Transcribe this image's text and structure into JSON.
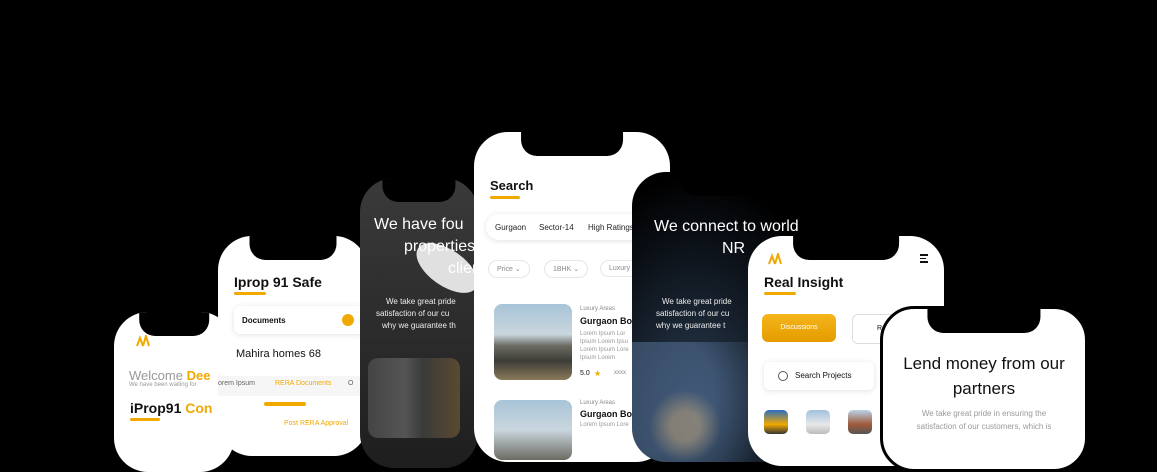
{
  "phone1": {
    "welcome": "Welcome",
    "welcome_highlight": "Dee",
    "subtitle": "We have been waiting for",
    "title_prefix": "iProp91",
    "title_highlight": "Con"
  },
  "phone2": {
    "title": "Iprop 91 Safe",
    "documents": "Documents",
    "project": "Mahira homes 68",
    "tabs": [
      "orem Ipsum",
      "RERA Documents",
      "O"
    ],
    "rera": "Post RERA Approval"
  },
  "phone3": {
    "headline_lines": [
      "We have fou",
      "properties",
      "clien"
    ],
    "body_lines": [
      "We take great pride",
      "satisfaction of our cu",
      "why we guarantee th"
    ]
  },
  "phone4": {
    "title": "Search",
    "filters": [
      "Gurgaon",
      "Sector-14",
      "High Ratings"
    ],
    "dropdowns": [
      "Price",
      "1BHK",
      "Luxury"
    ],
    "listings": [
      {
        "category": "Luxury Areas",
        "name": "Gurgaon Bo",
        "desc_lines": [
          "Lorem Ipsum Lor",
          "Ipsum Lorem Ipsu",
          "Lorem Ipsum Lore",
          "Ipsum Lorem"
        ],
        "rating": "5.0",
        "extra": "xxxx"
      },
      {
        "category": "Luxury Areas",
        "name": "Gurgaon Bo",
        "desc_lines": [
          "Lorem Ipsum Lore"
        ],
        "rating": "",
        "extra": ""
      }
    ]
  },
  "phone5": {
    "headline_lines": [
      "We connect to world",
      "NR"
    ],
    "body_lines": [
      "We take great pride",
      "satisfaction of our cu",
      "why we guarantee t"
    ]
  },
  "phone6": {
    "title": "Real Insight",
    "discussions": "Discussions",
    "second_tab": "R",
    "search": "Search Projects"
  },
  "phone7": {
    "headline_lines": [
      "Lend money from our",
      "partners"
    ],
    "body_lines": [
      "We take great pride in ensuring the",
      "satisfaction of our customers, which is"
    ]
  },
  "colors": {
    "accent": "#f1a900",
    "background": "#000000"
  }
}
